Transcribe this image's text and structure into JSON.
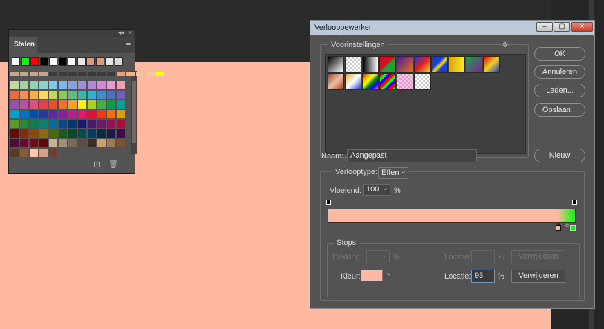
{
  "swatches_panel": {
    "tab_label": "Stalen",
    "collapse_glyph": "◂◂",
    "close_glyph": "×",
    "menu_glyph": "≡",
    "new_glyph": "⊡",
    "trash_glyph": "🗑",
    "recent_colors": [
      "#ffffff",
      "#00ff00",
      "#ff0000",
      "#000000",
      "#ffffff",
      "#000000",
      "#ffffff",
      "#e6e6e6",
      "#d49e84",
      "#d49e84",
      "#e6e6e6",
      "#d9d9d9"
    ],
    "rows": [
      [
        "#c8a88a",
        "#c8a88a",
        "#c8a88a",
        "#c8a88a",
        "#3a3a3a",
        "#3a3a3a",
        "#3a3a3a",
        "#3a3a3a",
        "#3a3a3a",
        "#3a3a3a",
        "#3a3a3a",
        "#f0a070",
        "#f4b082",
        "#f4c098",
        "#f7c89c",
        "#ffff00"
      ],
      [
        "#c1d99d",
        "#a3d3a3",
        "#8fd2b6",
        "#8bd3d3",
        "#7ec9e8",
        "#7fb6e6",
        "#8c9fdd",
        "#9c8fd2",
        "#b28ad0",
        "#d08ad0",
        "#e89ad0",
        "#f0a0b0"
      ],
      [
        "#f06a45",
        "#f69050",
        "#f8b050",
        "#fcd85e",
        "#c5d65e",
        "#8dc863",
        "#5ebc80",
        "#40b4a4",
        "#3aaed0",
        "#3a90d4",
        "#5070c0",
        "#7060b8"
      ],
      [
        "#9a4eb0",
        "#c04e9e",
        "#e24e7e",
        "#e84048",
        "#ea5030",
        "#f07030",
        "#f8a020",
        "#fff200",
        "#a8d020",
        "#40b040",
        "#00a050",
        "#00a098"
      ],
      [
        "#00a0d0",
        "#0070c0",
        "#0050a8",
        "#283a98",
        "#5a2a98",
        "#8a2098",
        "#b8208a",
        "#e2186a",
        "#e01030",
        "#e83c10",
        "#f07010",
        "#d8a010"
      ],
      [
        "#5a9a20",
        "#2a8a3a",
        "#0a8050",
        "#0a8078",
        "#0a6a98",
        "#0a4a88",
        "#0a3478",
        "#1a1a6a",
        "#4a1a6a",
        "#701868",
        "#98105a",
        "#a01038"
      ],
      [
        "#6a0a0a",
        "#8a2a0a",
        "#8a4a0a",
        "#8a6a0a",
        "#4a6a0a",
        "#1a5a1a",
        "#0a4a2a",
        "#0a4a4a",
        "#0a3a5a",
        "#0a2a4a",
        "#1a1a4a",
        "#3a0a4a"
      ],
      [
        "#4a0a3a",
        "#6a0a2a",
        "#6a0a1a",
        "#5a0a0a",
        "#c8b49a",
        "#a0907a",
        "#7a6a5a",
        "#5a4e42",
        "#3a302a",
        "#c8a070",
        "#a07a50",
        "#7a5530"
      ],
      [
        "#5a3a20",
        "#8a5a34",
        "#ffcab0",
        "#d4a088",
        "#6a4030"
      ]
    ]
  },
  "dialog": {
    "title": "Verloopbewerker",
    "win_min": "–",
    "win_max": "▢",
    "win_close": "✕",
    "presets_label": "Voorinstellingen",
    "presets_gear": "✲.",
    "buttons": {
      "ok": "OK",
      "cancel": "Annuleren",
      "load": "Laden...",
      "save": "Opslaan...",
      "new": "Nieuw"
    },
    "name_label": "Naam:",
    "name_value": "Aangepast",
    "gradient_type_label": "Verlooptype:",
    "gradient_type_value": "Effen",
    "smoothness_label": "Vloeiend:",
    "smoothness_value": "100",
    "smoothness_unit": "%",
    "dropdown_glyph": "⌄",
    "gradient": {
      "start_color": "#ffb9a3",
      "end_color": "#00ff00",
      "midpoint_glyph": "◇",
      "selected_stop_location": 93
    },
    "stops": {
      "group_label": "Stops",
      "opacity_label": "Dekking:",
      "opacity_unit": "%",
      "location_label_top": "Locatie:",
      "location_unit_top": "%",
      "delete_top": "Verwijderen",
      "color_label": "Kleur:",
      "color_value": "#ffb9a3",
      "location_label": "Locatie:",
      "location_value": "93",
      "location_unit": "%",
      "delete": "Verwijderen"
    }
  }
}
